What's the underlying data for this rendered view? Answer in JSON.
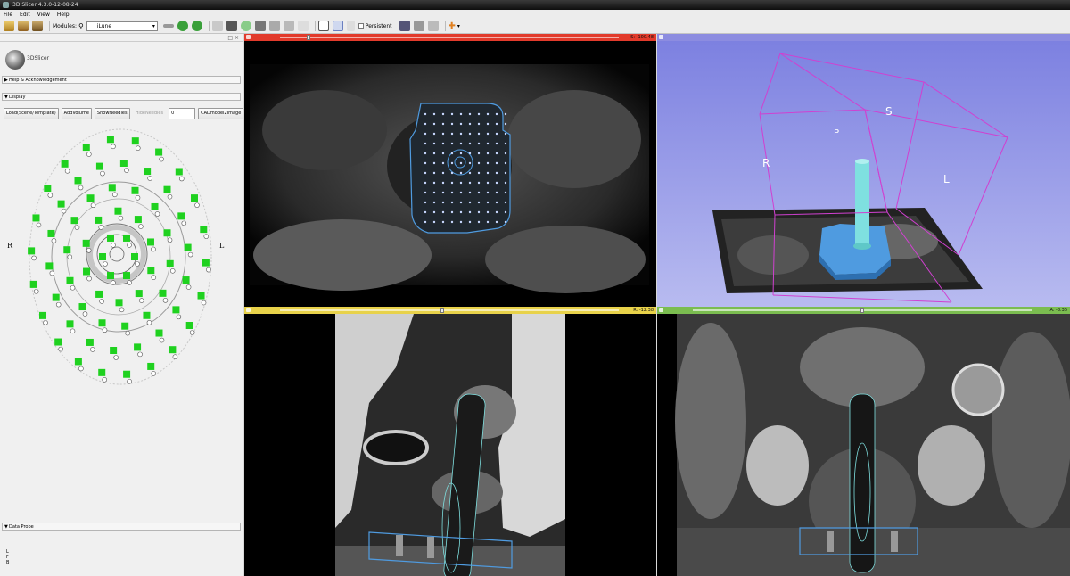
{
  "window": {
    "title": "3D Slicer 4.3.0-12-08-24"
  },
  "menu": [
    "File",
    "Edit",
    "View",
    "Help"
  ],
  "toolbar": {
    "modules_label": "Modules:",
    "module_selected": "iLune",
    "persistent_label": "Persistent"
  },
  "panel": {
    "logo_text": "3DSlicer",
    "help_section": "Help & Acknowledgement",
    "display_section": "Display",
    "data_probe_section": "Data Probe",
    "buttons": {
      "load": "Load(Scene/Template)",
      "add_volume": "AddVolume",
      "show_needles": "ShowNeedles",
      "hide_needles": "HideNeedles",
      "cad": "CADmodel2Image"
    },
    "spin_value": "0",
    "side_left": "R",
    "side_right": "L",
    "probe_letters": [
      "L",
      "F",
      "B"
    ]
  },
  "views": {
    "red": {
      "color": "#e23a2b",
      "offset": "S: -100.48"
    },
    "yellow": {
      "color": "#e8d24a",
      "offset": "R: -12.38"
    },
    "green": {
      "color": "#7bbd50",
      "offset": "A: -8.35"
    },
    "three_d": {
      "color": "#8c8ce0",
      "labels": {
        "S": "S",
        "P": "P",
        "R": "R",
        "L": "L"
      }
    }
  },
  "colors": {
    "hole_green": "#1fd11f",
    "template_blue": "#4f9be0",
    "needle_cyan": "#7fe0e0",
    "box_magenta": "#d040d0"
  },
  "icons": [
    "load-data-icon",
    "load-dicom-icon",
    "save-icon",
    "search-icon",
    "back-arrow-icon",
    "forward-arrow-icon",
    "home-icon",
    "layout-icon",
    "mouse-mode-icon",
    "crosshair-icon"
  ]
}
